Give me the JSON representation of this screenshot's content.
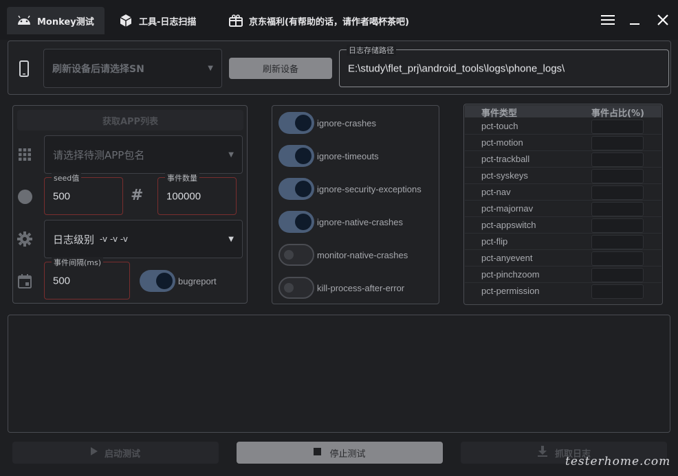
{
  "tabs": [
    {
      "label": "Monkey测试",
      "icon": "android-icon"
    },
    {
      "label": "工具-日志扫描",
      "icon": "cube-icon"
    },
    {
      "label": "京东福利(有帮助的话，请作者喝杯茶吧)",
      "icon": "gift-icon"
    }
  ],
  "device": {
    "select_placeholder": "刷新设备后请选择SN",
    "refresh_button": "刷新设备",
    "log_path_label": "日志存储路径",
    "log_path_value": "E:\\study\\flet_prj\\android_tools\\logs\\phone_logs\\"
  },
  "config": {
    "get_app_list": "获取APP列表",
    "app_select_placeholder": "请选择待测APP包名",
    "seed_label": "seed值",
    "seed_value": "500",
    "event_count_label": "事件数量",
    "event_count_value": "100000",
    "log_level_label": "日志级别",
    "log_level_value": "-v -v -v",
    "interval_label": "事件间隔(ms)",
    "interval_value": "500",
    "bugreport_label": "bugreport",
    "bugreport_on": true
  },
  "options": [
    {
      "label": "ignore-crashes",
      "on": true
    },
    {
      "label": "ignore-timeouts",
      "on": true
    },
    {
      "label": "ignore-security-exceptions",
      "on": true
    },
    {
      "label": "ignore-native-crashes",
      "on": true
    },
    {
      "label": "monitor-native-crashes",
      "on": false
    },
    {
      "label": "kill-process-after-error",
      "on": false
    }
  ],
  "event_table": {
    "col_type": "事件类型",
    "col_ratio": "事件占比(%)",
    "rows": [
      "pct-touch",
      "pct-motion",
      "pct-trackball",
      "pct-syskeys",
      "pct-nav",
      "pct-majornav",
      "pct-appswitch",
      "pct-flip",
      "pct-anyevent",
      "pct-pinchzoom",
      "pct-permission"
    ]
  },
  "actions": {
    "start": "启动测试",
    "stop": "停止测试",
    "fetch_log": "抓取日志"
  },
  "watermark": "testerhome.com"
}
